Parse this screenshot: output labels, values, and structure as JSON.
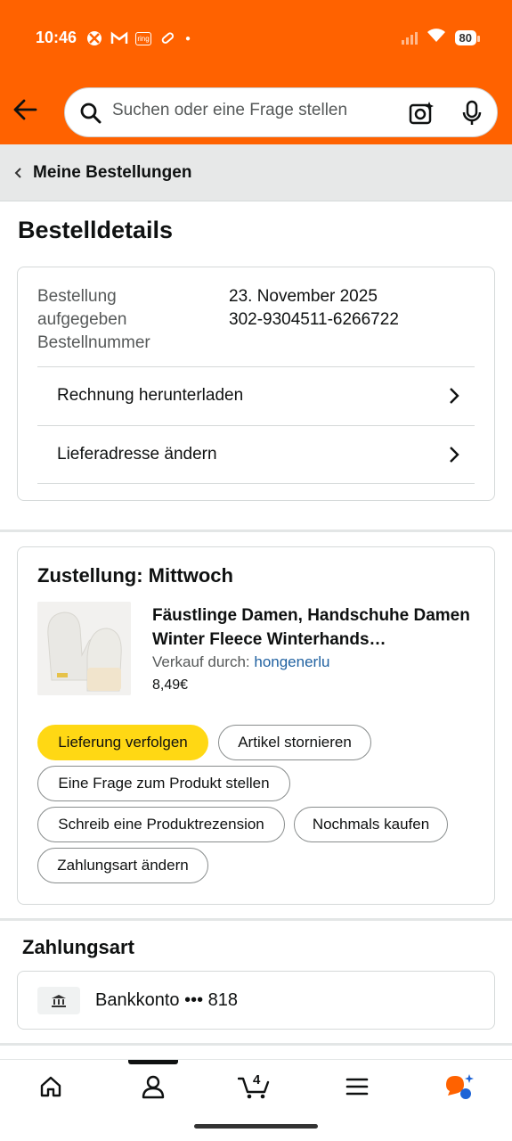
{
  "status_bar": {
    "time": "10:46",
    "battery": "80",
    "app_icon_ring": "ring"
  },
  "search": {
    "placeholder": "Suchen oder eine Frage stellen"
  },
  "breadcrumb": {
    "label": "Meine Bestellungen"
  },
  "page_title": "Bestelldetails",
  "order": {
    "labels": [
      "Bestellung",
      "aufgegeben",
      "Bestellnummer"
    ],
    "date": "23. November 2025",
    "number": "302-9304511-6266722",
    "links": [
      "Rechnung herunterladen",
      "Lieferadresse ändern"
    ]
  },
  "delivery": {
    "title": "Zustellung: Mittwoch",
    "product_title": "Fäustlinge Damen, Handschuhe Damen Winter Fleece Winterhands…",
    "seller_label": "Verkauf durch:",
    "seller_name": "hongenerlu",
    "price": "8,49€",
    "buttons": {
      "track": "Lieferung verfolgen",
      "cancel": "Artikel stornieren",
      "question": "Eine Frage zum Produkt stellen",
      "review": "Schreib eine Produktrezension",
      "buy_again": "Nochmals kaufen",
      "change_payment": "Zahlungsart ändern"
    }
  },
  "payment": {
    "title": "Zahlungsart",
    "method": "Bankkonto ••• 818"
  },
  "bottom_nav": {
    "cart_count": "4"
  },
  "colors": {
    "header": "#ff6200",
    "primary_button": "#ffd814",
    "link": "#2162a1"
  }
}
